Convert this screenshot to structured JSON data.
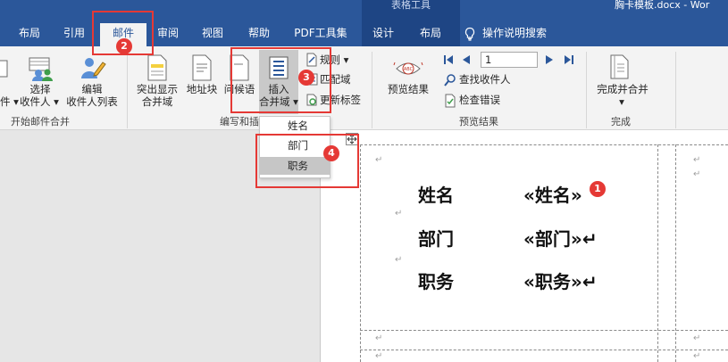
{
  "window": {
    "title": "胸卡模板.docx - Wor",
    "context_tab_group": "表格工具"
  },
  "tabs": [
    {
      "label": "布局"
    },
    {
      "label": "引用"
    },
    {
      "label": "邮件",
      "active": true
    },
    {
      "label": "审阅"
    },
    {
      "label": "视图"
    },
    {
      "label": "帮助"
    },
    {
      "label": "PDF工具集"
    },
    {
      "label": "设计"
    },
    {
      "label": "布局"
    },
    {
      "label": "操作说明搜索",
      "icon": "lightbulb-icon"
    }
  ],
  "ribbon": {
    "groups": {
      "start_merge": {
        "label": "开始邮件合并",
        "buttons": {
          "select_recipients": {
            "line1": "选择",
            "line2": "收件人 ▾",
            "icon": "recipients-icon"
          },
          "edit_recipients": {
            "line1": "编辑",
            "line2": "收件人列表",
            "icon": "edit-recipients-icon"
          }
        },
        "partial_label": "件 ▾"
      },
      "write_insert": {
        "label": "编写和插",
        "buttons": {
          "highlight": {
            "line1": "突出显示",
            "line2": "合并域",
            "icon": "highlight-fields-icon"
          },
          "address_block": {
            "line1": "地址块",
            "icon": "address-block-icon"
          },
          "greeting": {
            "line1": "问候语",
            "icon": "greeting-line-icon"
          },
          "insert_field": {
            "line1": "插入",
            "line2": "合并域 ▾",
            "icon": "insert-merge-field-icon"
          }
        },
        "small_buttons": {
          "rules": "规则 ▾",
          "match_fields": "匹配域",
          "update_labels": "更新标签"
        }
      },
      "preview": {
        "label": "预览结果",
        "buttons": {
          "preview_results": {
            "line1": "预览结果",
            "icon": "preview-abc-icon"
          }
        },
        "record_value": "1",
        "find_recipient": "查找收件人",
        "check_errors": "检查错误"
      },
      "finish": {
        "label": "完成",
        "buttons": {
          "finish_merge": {
            "line1": "完成并合并",
            "line2": "▾",
            "icon": "finish-merge-icon"
          }
        }
      }
    }
  },
  "dropdown": {
    "items": [
      "姓名",
      "部门",
      "职务"
    ],
    "highlighted": "职务"
  },
  "document": {
    "rows": [
      {
        "label": "姓名",
        "value": "«姓名»"
      },
      {
        "label": "部门",
        "value": "«部门»↵"
      },
      {
        "label": "职务",
        "value": "«职务»↵"
      }
    ],
    "paragraph_mark": "↵",
    "move_handle": "move-table-handle-icon"
  },
  "annotations": {
    "badges": [
      "1",
      "2",
      "3",
      "4"
    ],
    "color": "#e53935"
  },
  "colors": {
    "ribbon_blue": "#2b579a",
    "ribbon_bg": "#f3f3f3",
    "annotation_red": "#e53935",
    "dropdown_highlight": "#c6c6c6"
  }
}
